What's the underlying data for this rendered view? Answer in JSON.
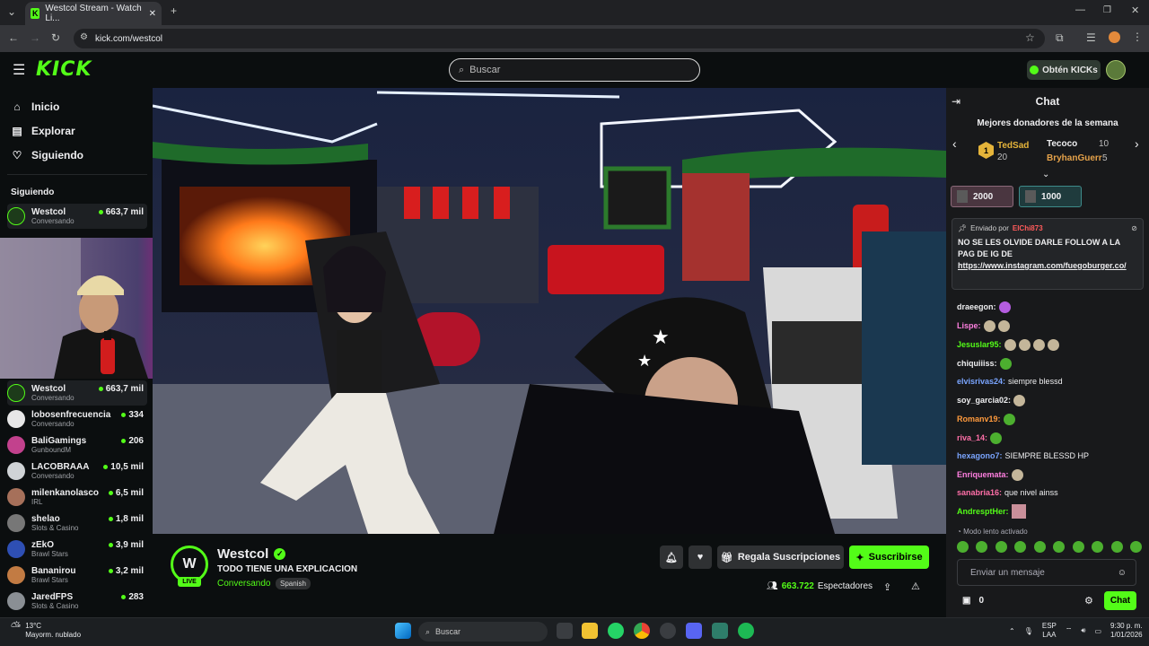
{
  "browser": {
    "tab_title": "Westcol Stream - Watch Li...",
    "url": "kick.com/westcol"
  },
  "header": {
    "logo": "KICK",
    "search_placeholder": "Buscar",
    "get_kicks": "Obtén KICKs"
  },
  "sidebar": {
    "nav": [
      {
        "label": "Inicio",
        "icon": "home-icon"
      },
      {
        "label": "Explorar",
        "icon": "explore-icon"
      },
      {
        "label": "Siguiendo",
        "icon": "heart-icon"
      }
    ],
    "following_title": "Siguiendo",
    "top_channel": {
      "name": "Westcol",
      "category": "Conversando",
      "viewers": "663,7 mil"
    },
    "channels": [
      {
        "name": "Westcol",
        "category": "Conversando",
        "viewers": "663,7 mil",
        "color": "#1d3b1a"
      },
      {
        "name": "lobosenfrecuencia",
        "category": "Conversando",
        "viewers": "334",
        "color": "#e7e7e7"
      },
      {
        "name": "BaliGamings",
        "category": "GunboundM",
        "viewers": "206",
        "color": "#c2418d"
      },
      {
        "name": "LACOBRAAA",
        "category": "Conversando",
        "viewers": "10,5 mil",
        "color": "#d0d3d6"
      },
      {
        "name": "milenkanolasco",
        "category": "IRL",
        "viewers": "6,5 mil",
        "color": "#a6705a"
      },
      {
        "name": "shelao",
        "category": "Slots & Casino",
        "viewers": "1,8 mil",
        "color": "#777"
      },
      {
        "name": "zEkO",
        "category": "Brawl Stars",
        "viewers": "3,9 mil",
        "color": "#2e4fb4"
      },
      {
        "name": "Bananirou",
        "category": "Brawl Stars",
        "viewers": "3,2 mil",
        "color": "#c27b43"
      },
      {
        "name": "JaredFPS",
        "category": "Slots & Casino",
        "viewers": "283",
        "color": "#8a8f94"
      }
    ]
  },
  "stream": {
    "streamer": "Westcol",
    "title": "TODO TIENE UNA EXPLICACION",
    "category": "Conversando",
    "language": "Spanish",
    "live_label": "LIVE",
    "gift_button": "Regala Suscripciones",
    "subscribe_button": "Suscribirse",
    "viewers_count": "663.722",
    "viewers_label": "Espectadores"
  },
  "chat": {
    "title": "Chat",
    "donors_title": "Mejores donadores de la semana",
    "donors": [
      {
        "rank": "1",
        "name": "TedSad",
        "amount": "20"
      },
      {
        "name": "Tecoco",
        "amount": "10"
      },
      {
        "name": "BryhanGuerr",
        "amount": "5"
      }
    ],
    "gift_tiers": [
      "2000",
      "1000"
    ],
    "pinned": {
      "label": "Enviado por",
      "author": "ElChi873",
      "message": "NO SE LES OLVIDE DARLE FOLLOW A LA PAG DE IG DE",
      "link": "https://www.instagram.com/fuegoburger.co/"
    },
    "messages": [
      {
        "user": "draeegon:",
        "text": "",
        "color": "#efeff1"
      },
      {
        "user": "Lispe:",
        "text": "",
        "color": "#ff7fe0"
      },
      {
        "user": "Jesuslar95:",
        "text": "",
        "color": "#53fc18"
      },
      {
        "user": "chiquiiiss:",
        "text": "",
        "color": "#efeff1"
      },
      {
        "user": "elvisrivas24:",
        "text": "siempre blessd",
        "color": "#7aa5ff"
      },
      {
        "user": "soy_garcia02:",
        "text": "",
        "color": "#efeff1"
      },
      {
        "user": "Romanv19:",
        "text": "",
        "color": "#ff9a3d"
      },
      {
        "user": "riva_14:",
        "text": "",
        "color": "#ff6fa8"
      },
      {
        "user": "hexagono7:",
        "text": "SIEMPRE BLESSD HP",
        "color": "#7aa5ff"
      },
      {
        "user": "Enriquemata:",
        "text": "",
        "color": "#ff7fe0"
      },
      {
        "user": "sanabria16:",
        "text": "que nivel ainss",
        "color": "#ff6fa8"
      },
      {
        "user": "AndresptHer:",
        "text": "",
        "color": "#53fc18"
      }
    ],
    "slow_mode": "Modo lento activado",
    "input_placeholder": "Enviar un mensaje",
    "count": "0",
    "send_button": "Chat"
  },
  "taskbar": {
    "temperature": "13°C",
    "weather": "Mayorm. nublado",
    "search": "Buscar",
    "lang_top": "ESP",
    "lang_bottom": "LAA",
    "time": "9:30 p. m.",
    "date": "1/01/2026"
  }
}
